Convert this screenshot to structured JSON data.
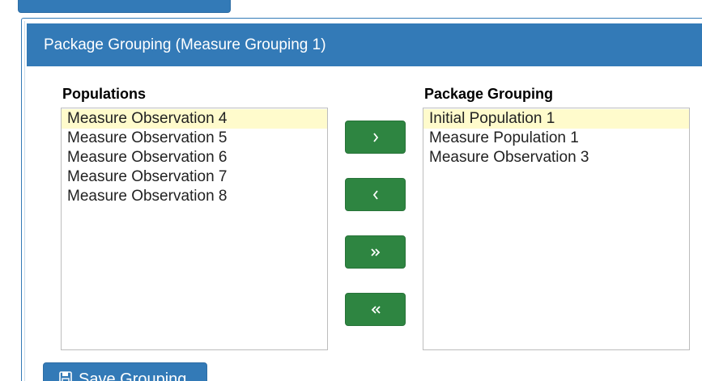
{
  "panel": {
    "title": "Package Grouping (Measure Grouping 1)"
  },
  "populations": {
    "label": "Populations",
    "items": [
      {
        "label": "Measure Observation 4",
        "selected": true
      },
      {
        "label": "Measure Observation 5",
        "selected": false
      },
      {
        "label": "Measure Observation 6",
        "selected": false
      },
      {
        "label": "Measure Observation 7",
        "selected": false
      },
      {
        "label": "Measure Observation 8",
        "selected": false
      }
    ]
  },
  "package_grouping": {
    "label": "Package Grouping",
    "items": [
      {
        "label": "Initial Population 1",
        "selected": true
      },
      {
        "label": "Measure Population 1",
        "selected": false
      },
      {
        "label": "Measure Observation 3",
        "selected": false
      }
    ]
  },
  "controls": {
    "move_right_icon": "chevron-right-icon",
    "move_left_icon": "chevron-left-icon",
    "move_all_right_icon": "double-chevron-right-icon",
    "move_all_left_icon": "double-chevron-left-icon"
  },
  "save_button": {
    "label": "Save Grouping",
    "icon": "floppy-disk-icon"
  },
  "colors": {
    "primary": "#337ab7",
    "success": "#2e8541",
    "selected_row": "#fffbcc"
  }
}
